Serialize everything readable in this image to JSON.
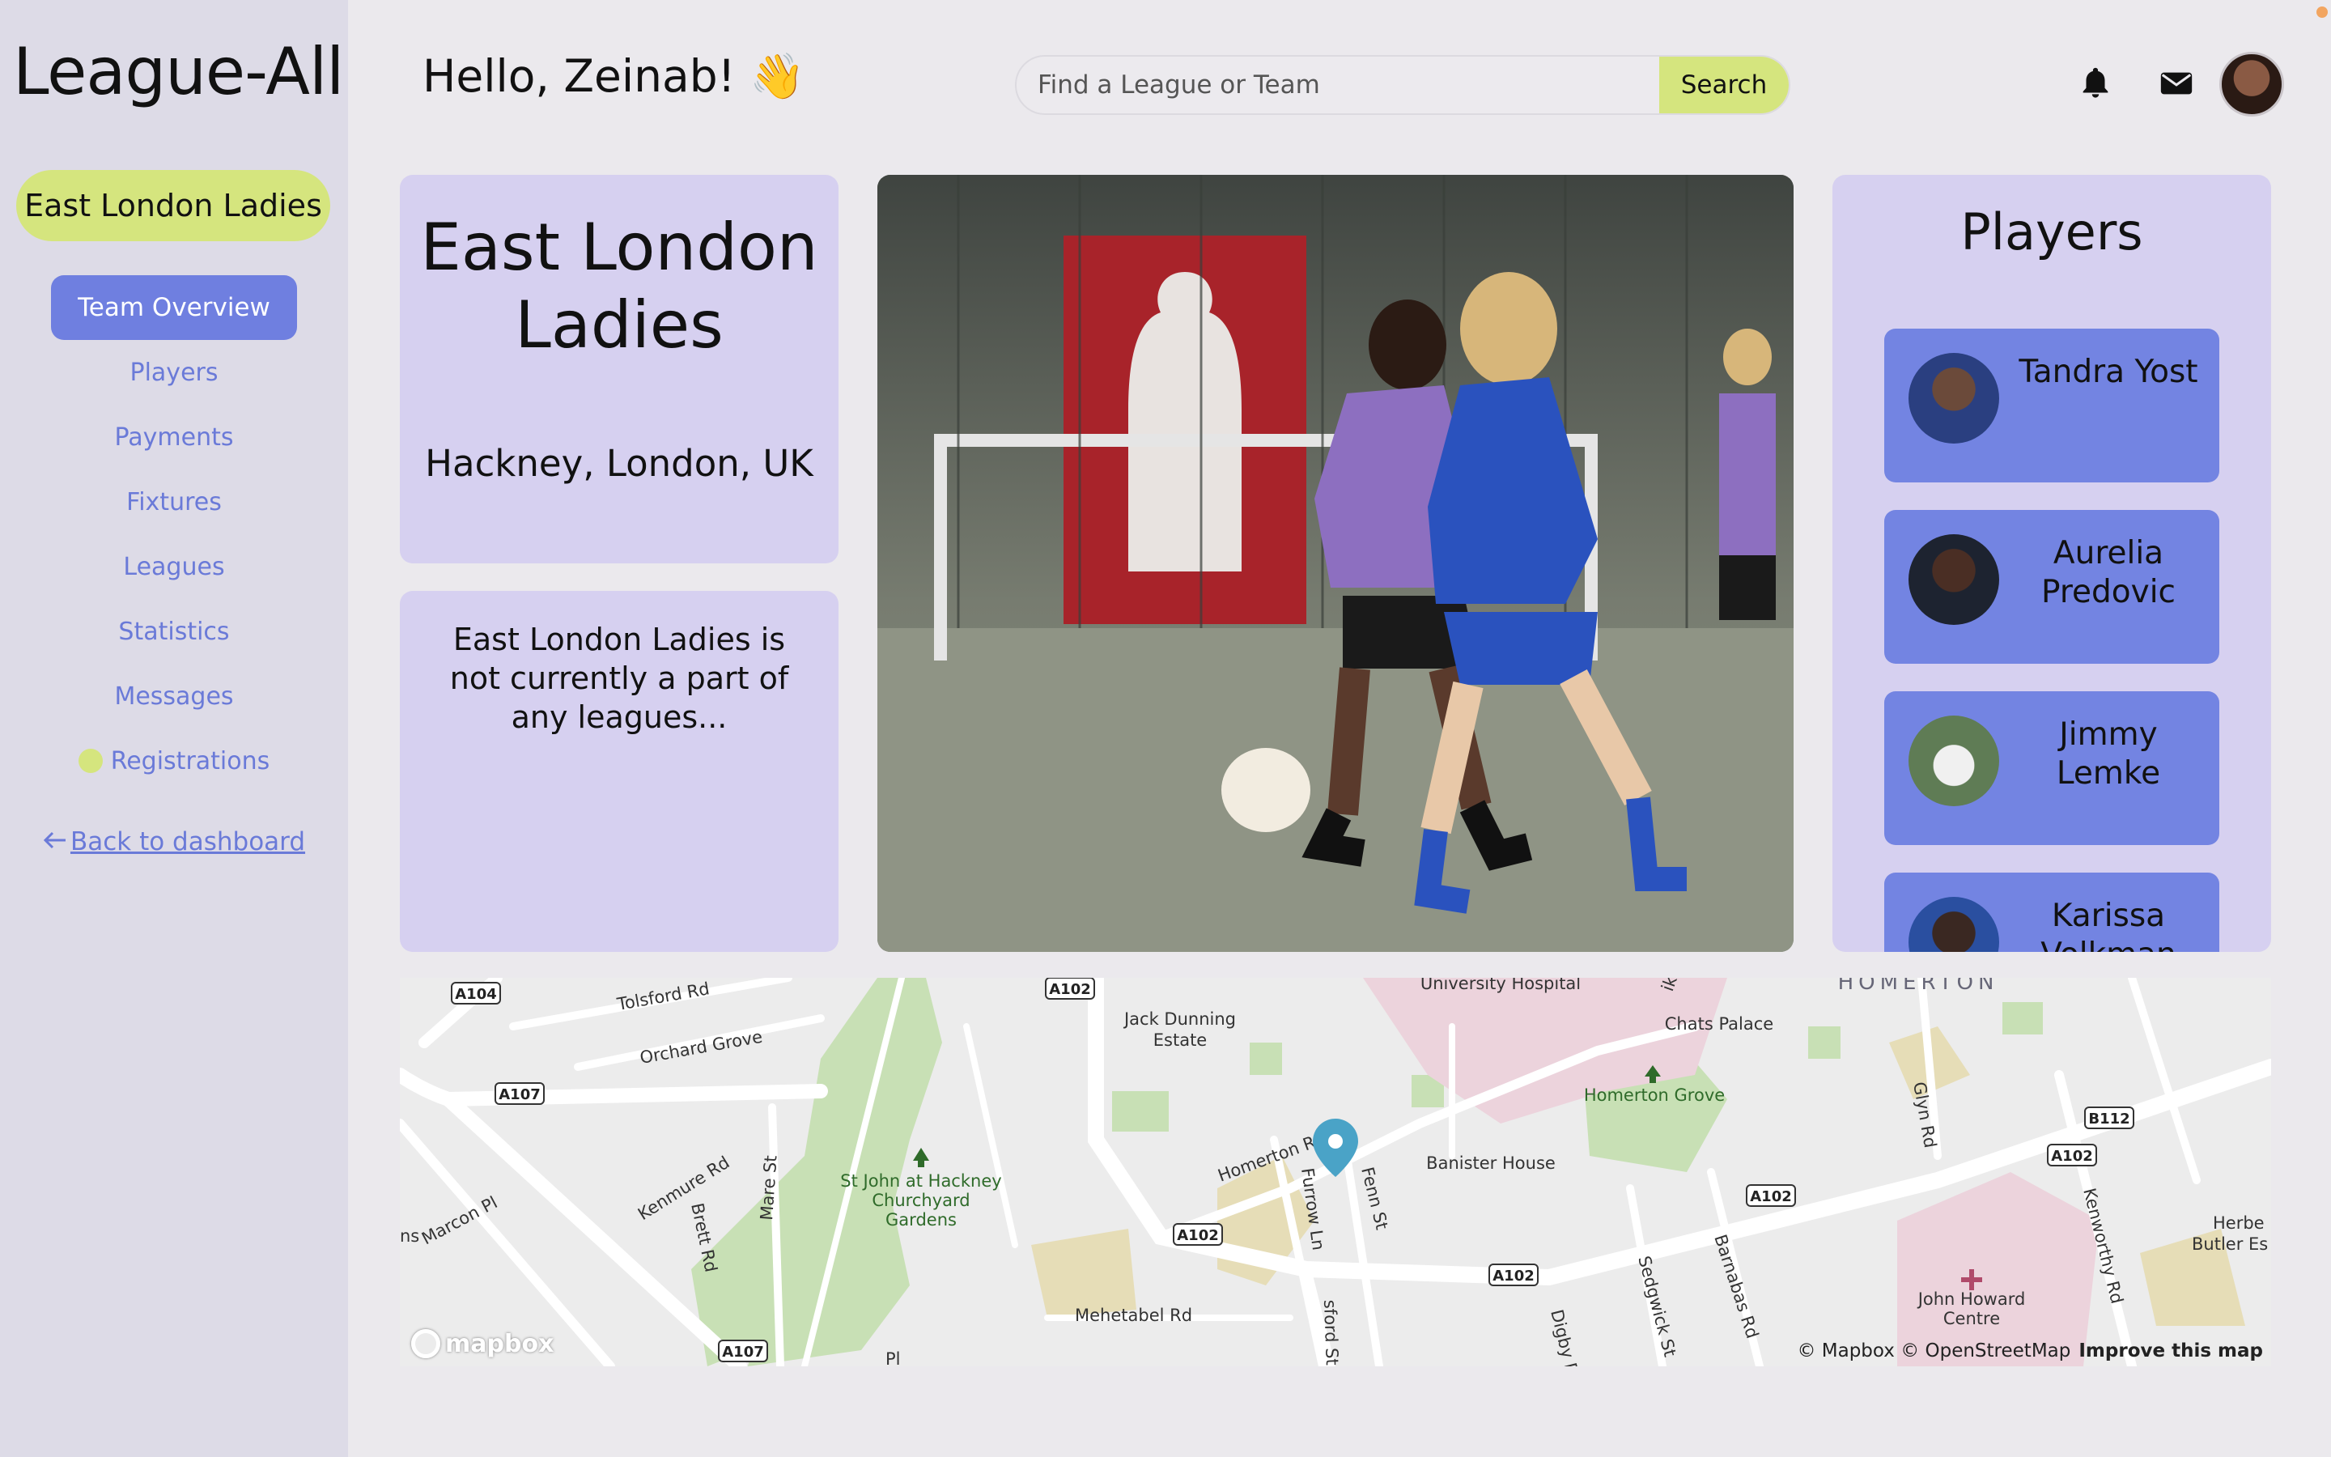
{
  "app": {
    "logo": "League-All"
  },
  "sidebar": {
    "team_name": "East London Ladies",
    "active_item": "Team Overview",
    "items": [
      "Players",
      "Payments",
      "Fixtures",
      "Leagues",
      "Statistics",
      "Messages"
    ],
    "registrations": "Registrations",
    "back_link": "Back to dashboard"
  },
  "header": {
    "greeting": "Hello, Zeinab! 👋",
    "search_placeholder": "Find a League or Team",
    "search_button": "Search"
  },
  "team": {
    "name": "East London Ladies",
    "location": "Hackney, London, UK",
    "description": "East London Ladies is not currently a part of any leagues..."
  },
  "players": {
    "title": "Players",
    "list": [
      "Tandra Yost",
      "Aurelia Predovic",
      "Jimmy Lemke",
      "Karissa Volkman"
    ]
  },
  "map": {
    "labels": {
      "tolsford": "Tolsford Rd",
      "orchard": "Orchard Grove",
      "jack1": "Jack Dunning",
      "jack2": "Estate",
      "uni": "University Hospital",
      "chats": "Chats Palace",
      "homerton": "HOMERTON",
      "homerton_grove": "Homerton Grove",
      "glyn": "Glyn Rd",
      "kenmure": "Kenmure Rd",
      "marcon": "Marcon Pl",
      "brett": "Brett Rd",
      "mare": "Mare St",
      "stjohn1": "St John at Hackney",
      "stjohn2": "Churchyard",
      "stjohn3": "Gardens",
      "homerton_rd": "Homerton Rd",
      "furrow": "Furrow Ln",
      "fenn": "Fenn St",
      "banister": "Banister House",
      "sedgwick": "Sedgwick St",
      "barnabas": "Barnabas Rd",
      "kenworthy": "Kenworthy Rd",
      "herbert1": "Herbe",
      "herbert2": "Butler Es",
      "john1": "John Howard",
      "john2": "Centre",
      "mehetabel": "Mehetabel Rd",
      "digby": "Digby R",
      "sford": "sford St",
      "pl": "Pl",
      "ns": "ns",
      "ik": "ik"
    },
    "shields": {
      "a104": "A104",
      "a102": "A102",
      "a107": "A107",
      "b112": "B112"
    },
    "logo": "mapbox",
    "attribution": "© Mapbox © OpenStreetMap",
    "improve": "Improve this map"
  }
}
